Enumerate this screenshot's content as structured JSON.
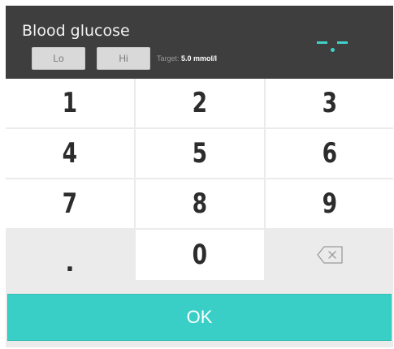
{
  "header": {
    "title": "Blood glucose",
    "lo_label": "Lo",
    "hi_label": "Hi",
    "target_label": "Target:",
    "target_value": "5.0 mmol/l",
    "display_placeholder": "-.-"
  },
  "keypad": {
    "keys": [
      "1",
      "2",
      "3",
      "4",
      "5",
      "6",
      "7",
      "8",
      "9",
      ".",
      "0"
    ],
    "backspace_icon": "backspace-icon"
  },
  "ok_label": "OK",
  "colors": {
    "accent": "#3acfc6",
    "header_bg": "#3e3e3e",
    "key_bg": "#ffffff",
    "muted_key_bg": "#ebebeb"
  }
}
